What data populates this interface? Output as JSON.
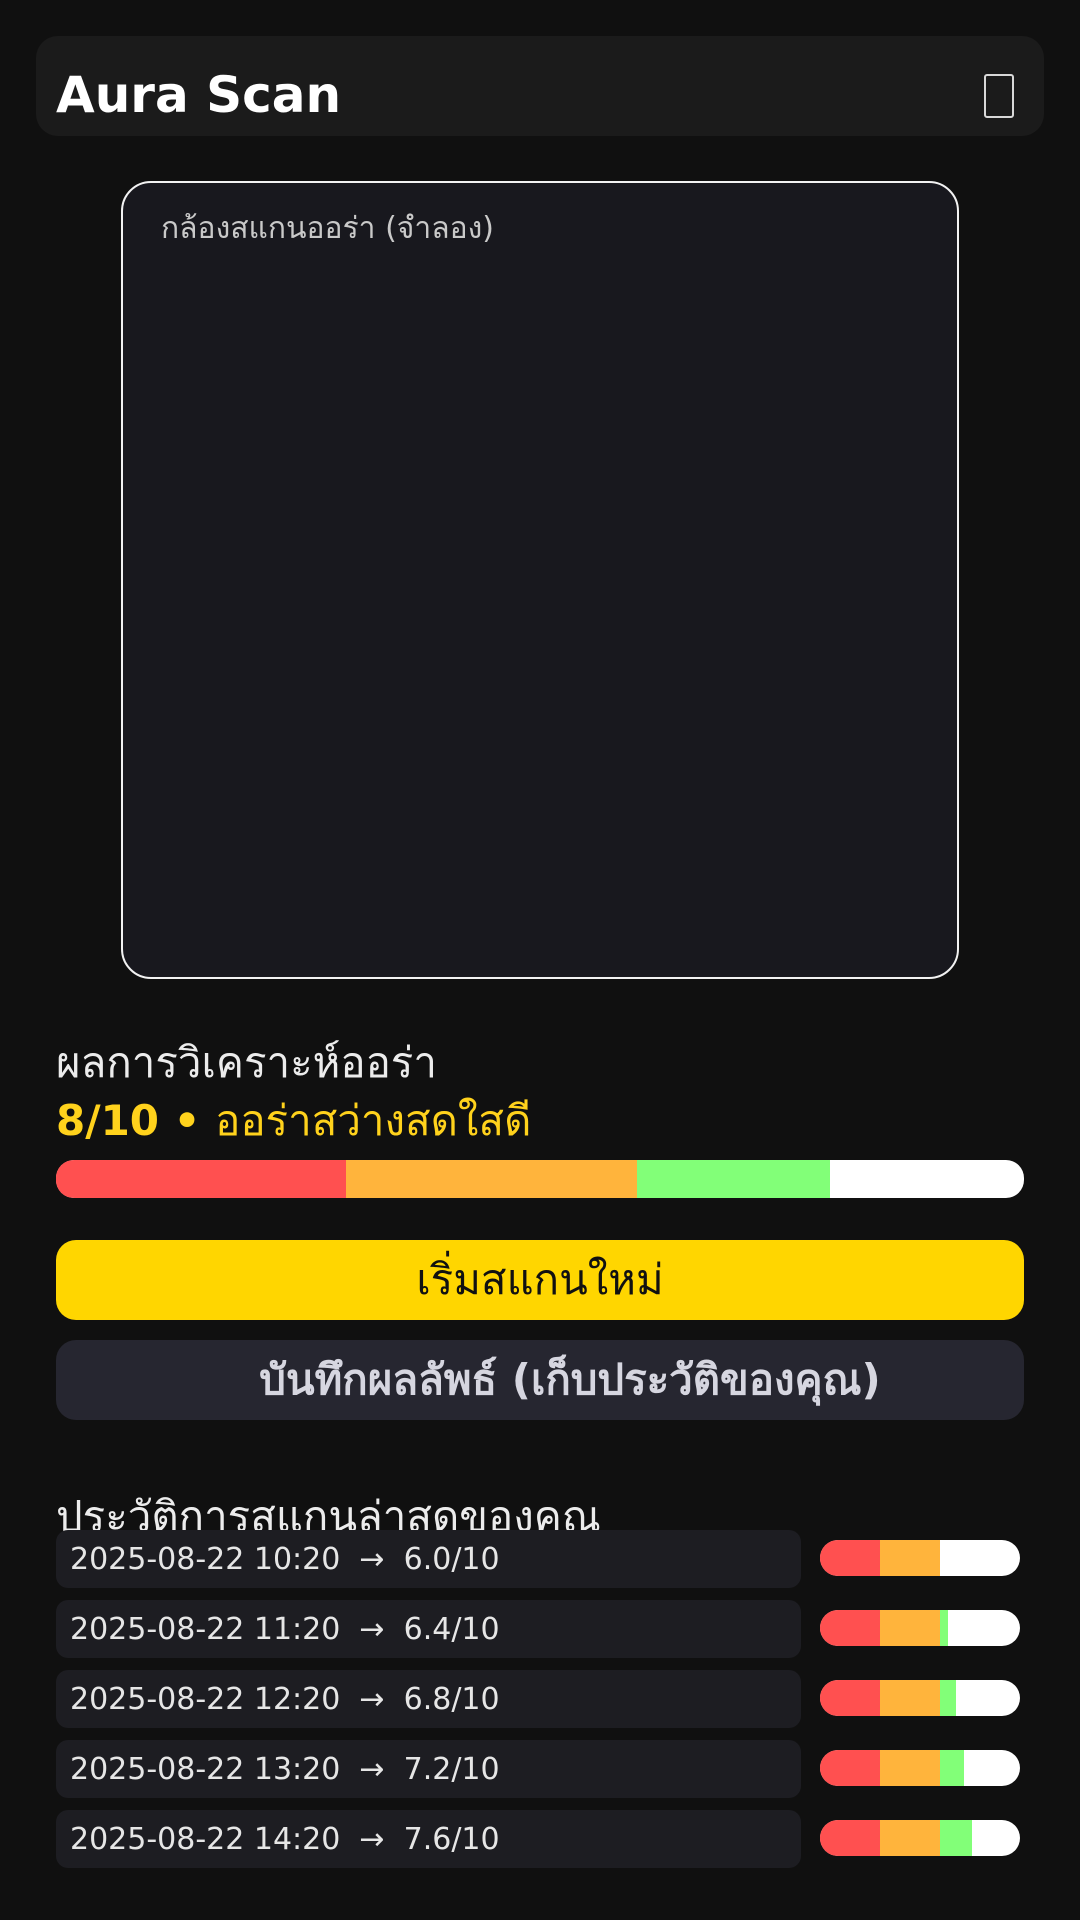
{
  "header": {
    "title": "Aura Scan",
    "menu_icon": "menu-icon"
  },
  "camera": {
    "label": "กล้องสแกนออร่า (จำลอง)"
  },
  "result": {
    "title": "ผลการวิเคราะห์ออร่า",
    "score": "8/10",
    "separator": " • ",
    "description": "ออร่าสว่างสดใสดี",
    "score_fraction": 0.8
  },
  "buttons": {
    "scan_label": "เริ่มสแกนใหม่",
    "secondary_label": "บันทึกผลลัพธ์ (เก็บประวัติของคุณ)"
  },
  "history": {
    "title": "ประวัติการสแกนล่าสุดของคุณ",
    "items": [
      {
        "text": "2025-08-22 10:20  →  6.0/10",
        "score": 6.0
      },
      {
        "text": "2025-08-22 11:20  →  6.4/10",
        "score": 6.4
      },
      {
        "text": "2025-08-22 12:20  →  6.8/10",
        "score": 6.8
      },
      {
        "text": "2025-08-22 13:20  →  7.2/10",
        "score": 7.2
      },
      {
        "text": "2025-08-22 14:20  →  7.6/10",
        "score": 7.6
      }
    ]
  },
  "colors": {
    "background": "#101010",
    "accent": "#ffd600",
    "score_text": "#ffd21c",
    "bar_red": "#ff5050",
    "bar_orange": "#ffb43c",
    "bar_green": "#82ff78"
  }
}
